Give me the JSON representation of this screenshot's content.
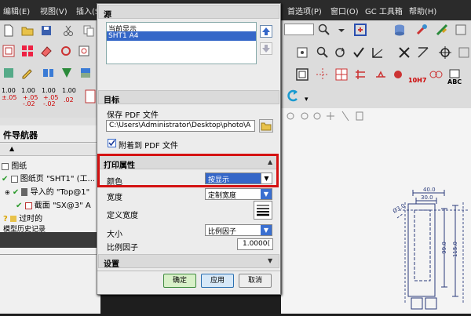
{
  "menubar": {
    "items": [
      "编辑(E)",
      "视图(V)",
      "插入(S)",
      "首选项(P)",
      "窗口(O)",
      "GC 工具箱",
      "帮助(H)"
    ]
  },
  "toolbar": {
    "numbers": [
      {
        "top": "1.00",
        "bottom": "±.05"
      },
      {
        "top": "1.00",
        "bottom": "+.05\n-.02"
      },
      {
        "top": "1.00",
        "bottom": "+.05\n-.02"
      },
      {
        "top": "1.00",
        "bottom": ".02"
      }
    ],
    "tolerance_label": "10H7",
    "abc_label": "ABC"
  },
  "navigator": {
    "title": "件导航器",
    "rows": [
      "图纸",
      "图纸页 \"SHT1\" (工...",
      "导入的 \"Top@1\"",
      "截面 \"SX@3\" A",
      "过时的",
      "模型历史记录"
    ]
  },
  "dialog": {
    "title": "源",
    "list": [
      "当前显示",
      "SHT1  A4"
    ],
    "target_header": "目标",
    "save_pdf_label": "保存 PDF 文件",
    "file_path": "C:\\Users\\Administrator\\Desktop\\photo\\A",
    "attach_label": "附着到 PDF 文件",
    "print_header": "打印属性",
    "color_label": "颜色",
    "color_value": "按显示",
    "width_label": "宽度",
    "width_value": "定制宽度",
    "define_width_label": "定义宽度",
    "size_label": "大小",
    "size_value": "比例因子",
    "scale_label": "比例因子",
    "scale_value": "1.0000(",
    "settings_header": "设置",
    "ok": "确定",
    "apply": "应用",
    "cancel": "取消"
  },
  "drawing": {
    "dims": [
      "40.0",
      "30.0",
      "Ø3.0",
      "99.0",
      "115.0"
    ]
  },
  "colors": {
    "accent": "#3567c8",
    "highlight": "#d41212"
  }
}
